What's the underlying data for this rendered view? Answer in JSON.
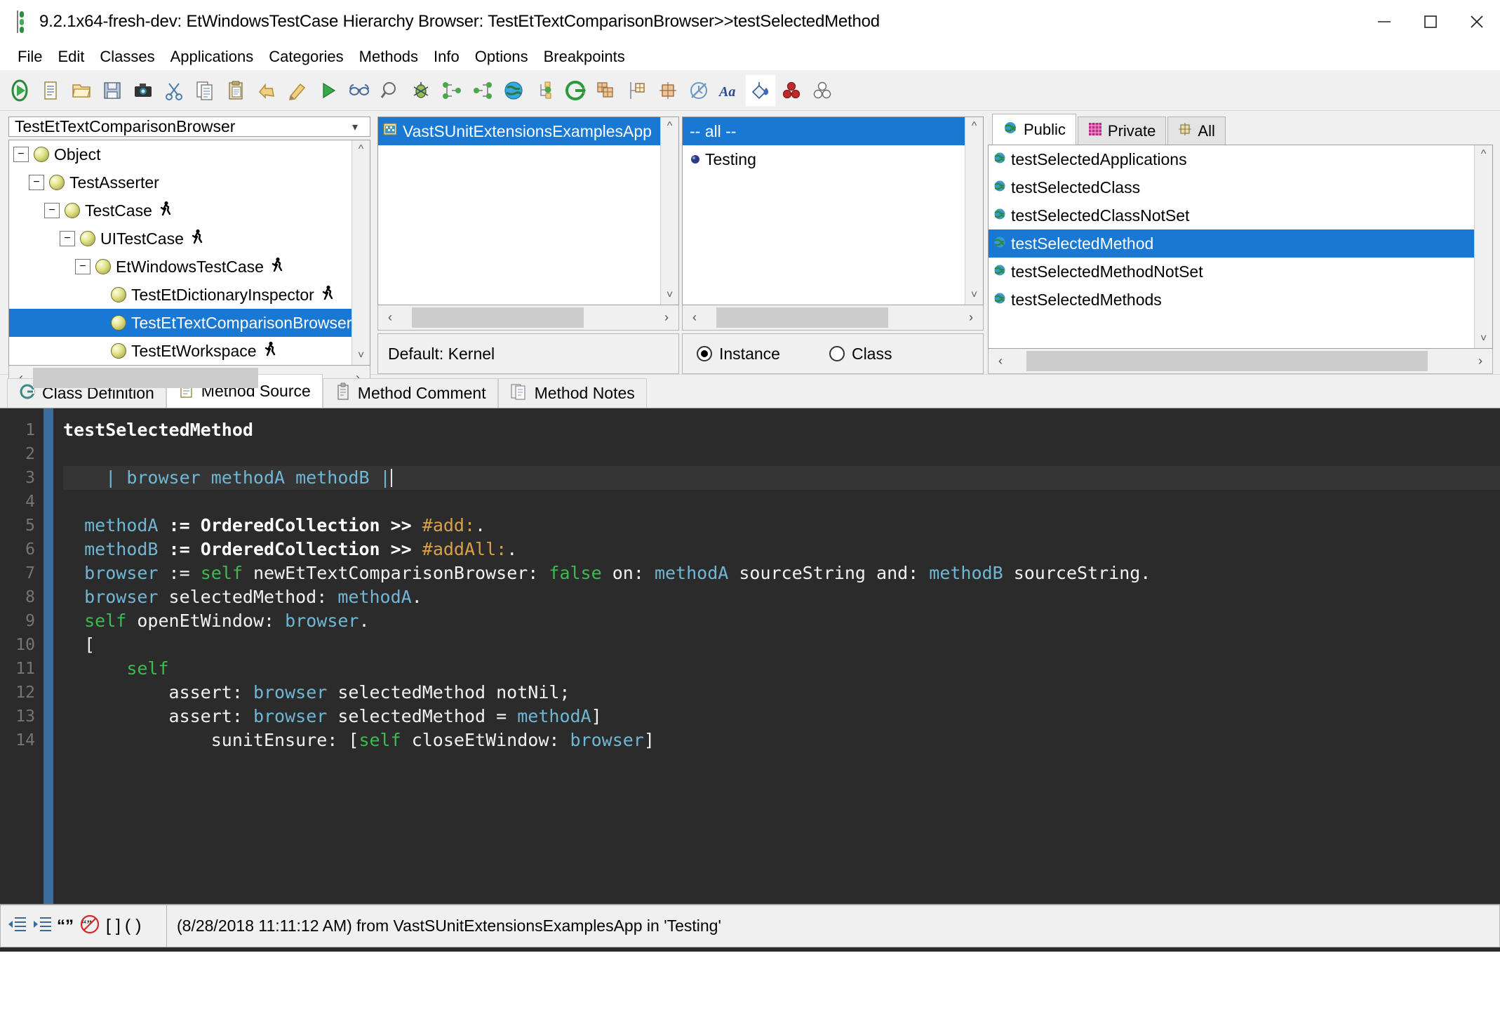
{
  "window": {
    "title": "9.2.1x64-fresh-dev: EtWindowsTestCase Hierarchy Browser: TestEtTextComparisonBrowser>>testSelectedMethod",
    "icon": "vast-window-icon",
    "minimize_label": "─",
    "maximize_label": "□",
    "close_label": "✕"
  },
  "menubar": {
    "items": [
      {
        "label": "File"
      },
      {
        "label": "Edit"
      },
      {
        "label": "Classes"
      },
      {
        "label": "Applications"
      },
      {
        "label": "Categories"
      },
      {
        "label": "Methods"
      },
      {
        "label": "Info"
      },
      {
        "label": "Options"
      },
      {
        "label": "Breakpoints"
      }
    ]
  },
  "toolbar": {
    "buttons": [
      {
        "name": "run-icon"
      },
      {
        "name": "new-file-icon"
      },
      {
        "name": "open-folder-icon"
      },
      {
        "name": "save-icon"
      },
      {
        "name": "camera-icon"
      },
      {
        "name": "cut-scissors-icon"
      },
      {
        "name": "copy-icon"
      },
      {
        "name": "paste-icon"
      },
      {
        "name": "undo-icon"
      },
      {
        "name": "redo-icon"
      },
      {
        "name": "play-green-icon"
      },
      {
        "name": "glasses-icon"
      },
      {
        "name": "magnifier-icon"
      },
      {
        "name": "debug-bug-icon"
      },
      {
        "name": "hierarchy-senders-icon"
      },
      {
        "name": "hierarchy-implementors-icon"
      },
      {
        "name": "globe-icon"
      },
      {
        "name": "tree-nodes-icon"
      },
      {
        "name": "refresh-green-icon"
      },
      {
        "name": "classes-stack-icon"
      },
      {
        "name": "class-table-icon"
      },
      {
        "name": "class-grid-icon"
      },
      {
        "name": "no-clock-icon"
      },
      {
        "name": "font-aa-icon"
      },
      {
        "name": "paint-bucket-icon",
        "active": true
      },
      {
        "name": "red-balls-icon"
      },
      {
        "name": "white-balls-icon"
      }
    ]
  },
  "classes_pane": {
    "combo_value": "TestEtTextComparisonBrowser",
    "tree": [
      {
        "label": "Object",
        "depth": 0,
        "expander": "−",
        "runner": false,
        "selected": false
      },
      {
        "label": "TestAsserter",
        "depth": 1,
        "expander": "−",
        "runner": false,
        "selected": false
      },
      {
        "label": "TestCase",
        "depth": 2,
        "expander": "−",
        "runner": true,
        "selected": false
      },
      {
        "label": "UITestCase",
        "depth": 3,
        "expander": "−",
        "runner": true,
        "selected": false
      },
      {
        "label": "EtWindowsTestCase",
        "depth": 4,
        "expander": "−",
        "runner": true,
        "selected": false
      },
      {
        "label": "TestEtDictionaryInspector",
        "depth": 5,
        "expander": "",
        "runner": true,
        "selected": false
      },
      {
        "label": "TestEtTextComparisonBrowser",
        "depth": 5,
        "expander": "",
        "runner": true,
        "selected": true
      },
      {
        "label": "TestEtWorkspace",
        "depth": 5,
        "expander": "",
        "runner": true,
        "selected": false
      }
    ],
    "visibility": {
      "public_label": "Public",
      "private_label": "Private",
      "selected": "Public"
    }
  },
  "apps_pane": {
    "items": [
      {
        "label": "VastSUnitExtensionsExamplesApp",
        "selected": true,
        "icon": "application-icon"
      }
    ],
    "default_label": "Default: Kernel"
  },
  "categories_pane": {
    "items": [
      {
        "label": "-- all --",
        "selected": true,
        "icon": null
      },
      {
        "label": "Testing",
        "selected": false,
        "icon": "category-icon"
      }
    ],
    "scope": {
      "instance_label": "Instance",
      "class_label": "Class",
      "selected": "Instance"
    }
  },
  "methods_pane": {
    "tabs": [
      {
        "label": "Public",
        "icon": "public-method-icon",
        "active": true
      },
      {
        "label": "Private",
        "icon": "private-method-icon",
        "active": false
      },
      {
        "label": "All",
        "icon": "all-methods-icon",
        "active": false
      }
    ],
    "items": [
      {
        "label": "testSelectedApplications",
        "selected": false
      },
      {
        "label": "testSelectedClass",
        "selected": false
      },
      {
        "label": "testSelectedClassNotSet",
        "selected": false
      },
      {
        "label": "testSelectedMethod",
        "selected": true
      },
      {
        "label": "testSelectedMethodNotSet",
        "selected": false
      },
      {
        "label": "testSelectedMethods",
        "selected": false
      }
    ]
  },
  "editor_tabs": [
    {
      "label": "Class Definition",
      "icon": "class-definition-icon",
      "active": false
    },
    {
      "label": "Method Source",
      "icon": "method-source-icon",
      "active": true
    },
    {
      "label": "Method Comment",
      "icon": "method-comment-icon",
      "active": false
    },
    {
      "label": "Method Notes",
      "icon": "method-notes-icon",
      "active": false
    }
  ],
  "code": {
    "line_numbers": [
      1,
      2,
      3,
      4,
      5,
      6,
      7,
      8,
      9,
      10,
      11,
      12,
      13,
      14
    ],
    "highlight_line": 3,
    "lines": [
      {
        "n": 1,
        "tokens": [
          {
            "t": "testSelectedMethod",
            "c": "tk-bold"
          }
        ]
      },
      {
        "n": 2,
        "tokens": []
      },
      {
        "n": 3,
        "tokens": [
          {
            "t": "    | ",
            "c": "tk-var"
          },
          {
            "t": "browser methodA methodB ",
            "c": "tk-var"
          },
          {
            "t": "|",
            "c": "tk-var"
          }
        ],
        "caret": true
      },
      {
        "n": 4,
        "tokens": []
      },
      {
        "n": 5,
        "tokens": [
          {
            "t": "  ",
            "c": "tk-white"
          },
          {
            "t": "methodA",
            "c": "tk-var"
          },
          {
            "t": " := ",
            "c": "tk-bold"
          },
          {
            "t": "OrderedCollection",
            "c": "tk-bold"
          },
          {
            "t": " >> ",
            "c": "tk-bold"
          },
          {
            "t": "#add:",
            "c": "tk-sym"
          },
          {
            "t": ".",
            "c": "tk-white"
          }
        ]
      },
      {
        "n": 6,
        "tokens": [
          {
            "t": "  ",
            "c": "tk-white"
          },
          {
            "t": "methodB",
            "c": "tk-var"
          },
          {
            "t": " := ",
            "c": "tk-bold"
          },
          {
            "t": "OrderedCollection",
            "c": "tk-bold"
          },
          {
            "t": " >> ",
            "c": "tk-bold"
          },
          {
            "t": "#addAll:",
            "c": "tk-sym"
          },
          {
            "t": ".",
            "c": "tk-white"
          }
        ]
      },
      {
        "n": 7,
        "tokens": [
          {
            "t": "  ",
            "c": "tk-white"
          },
          {
            "t": "browser",
            "c": "tk-var"
          },
          {
            "t": " := ",
            "c": "tk-white"
          },
          {
            "t": "self",
            "c": "tk-kw"
          },
          {
            "t": " newEtTextComparisonBrowser: ",
            "c": "tk-white"
          },
          {
            "t": "false",
            "c": "tk-kw"
          },
          {
            "t": " on: ",
            "c": "tk-white"
          },
          {
            "t": "methodA",
            "c": "tk-var"
          },
          {
            "t": " sourceString and: ",
            "c": "tk-white"
          },
          {
            "t": "methodB",
            "c": "tk-var"
          },
          {
            "t": " sourceString.",
            "c": "tk-white"
          }
        ]
      },
      {
        "n": 8,
        "tokens": [
          {
            "t": "  ",
            "c": "tk-white"
          },
          {
            "t": "browser",
            "c": "tk-var"
          },
          {
            "t": " selectedMethod: ",
            "c": "tk-white"
          },
          {
            "t": "methodA",
            "c": "tk-var"
          },
          {
            "t": ".",
            "c": "tk-white"
          }
        ]
      },
      {
        "n": 9,
        "tokens": [
          {
            "t": "  ",
            "c": "tk-white"
          },
          {
            "t": "self",
            "c": "tk-kw"
          },
          {
            "t": " openEtWindow: ",
            "c": "tk-white"
          },
          {
            "t": "browser",
            "c": "tk-var"
          },
          {
            "t": ".",
            "c": "tk-white"
          }
        ]
      },
      {
        "n": 10,
        "tokens": [
          {
            "t": "  [",
            "c": "tk-white"
          }
        ]
      },
      {
        "n": 11,
        "tokens": [
          {
            "t": "      ",
            "c": "tk-white"
          },
          {
            "t": "self",
            "c": "tk-kw"
          }
        ]
      },
      {
        "n": 12,
        "tokens": [
          {
            "t": "          assert: ",
            "c": "tk-white"
          },
          {
            "t": "browser",
            "c": "tk-var"
          },
          {
            "t": " selectedMethod notNil;",
            "c": "tk-white"
          }
        ]
      },
      {
        "n": 13,
        "tokens": [
          {
            "t": "          assert: ",
            "c": "tk-white"
          },
          {
            "t": "browser",
            "c": "tk-var"
          },
          {
            "t": " selectedMethod = ",
            "c": "tk-white"
          },
          {
            "t": "methodA",
            "c": "tk-var"
          },
          {
            "t": "]",
            "c": "tk-white"
          }
        ]
      },
      {
        "n": 14,
        "tokens": [
          {
            "t": "              sunitEnsure: [",
            "c": "tk-white"
          },
          {
            "t": "self",
            "c": "tk-kw"
          },
          {
            "t": " closeEtWindow: ",
            "c": "tk-white"
          },
          {
            "t": "browser",
            "c": "tk-var"
          },
          {
            "t": "]",
            "c": "tk-white"
          }
        ]
      }
    ]
  },
  "statusbar": {
    "icons": [
      {
        "name": "outdent-icon"
      },
      {
        "name": "indent-icon"
      },
      {
        "name": "quote-icon"
      },
      {
        "name": "unquote-icon"
      },
      {
        "name": "brackets-icon"
      },
      {
        "name": "parens-icon"
      }
    ],
    "message": "(8/28/2018 11:11:12 AM) from VastSUnitExtensionsExamplesApp in 'Testing'"
  },
  "colors": {
    "selection_blue": "#1878d4",
    "toolbar_bg": "#f0f0f0",
    "editor_bg": "#2b2b2b",
    "gutter_bar": "#3c6e9c"
  }
}
